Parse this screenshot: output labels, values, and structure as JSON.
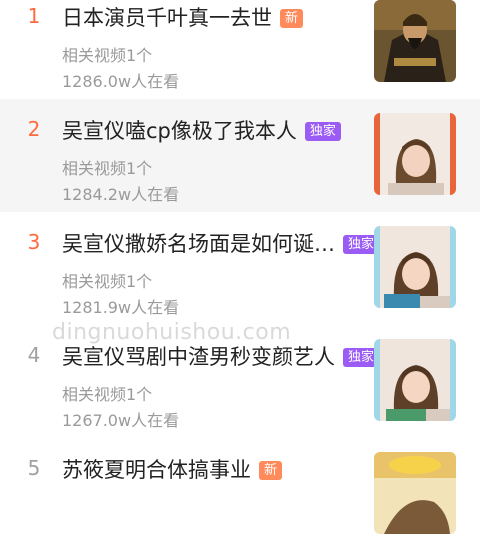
{
  "items": [
    {
      "rank": "1",
      "title": "日本演员千叶真一去世",
      "badge": "新",
      "related": "相关视频1个",
      "watching": "1286.0w人在看"
    },
    {
      "rank": "2",
      "title": "吴宣仪嗑cp像极了我本人",
      "badge": "独家",
      "related": "相关视频1个",
      "watching": "1284.2w人在看"
    },
    {
      "rank": "3",
      "title": "吴宣仪撒娇名场面是如何诞…",
      "badge": "独家",
      "related": "相关视频1个",
      "watching": "1281.9w人在看"
    },
    {
      "rank": "4",
      "title": "吴宣仪骂剧中渣男秒变颜艺人",
      "badge": "独家",
      "related": "相关视频1个",
      "watching": "1267.0w人在看"
    },
    {
      "rank": "5",
      "title": "苏筱夏明合体搞事业",
      "badge": "新",
      "related": "",
      "watching": ""
    }
  ],
  "watermark": "dingnuohuishou.com",
  "colors": {
    "rank_hot": "#ff6a3d",
    "rank_normal": "#a0a0a0",
    "badge_new": "#ff8a5b",
    "badge_exclusive": "#9b5cf6"
  }
}
